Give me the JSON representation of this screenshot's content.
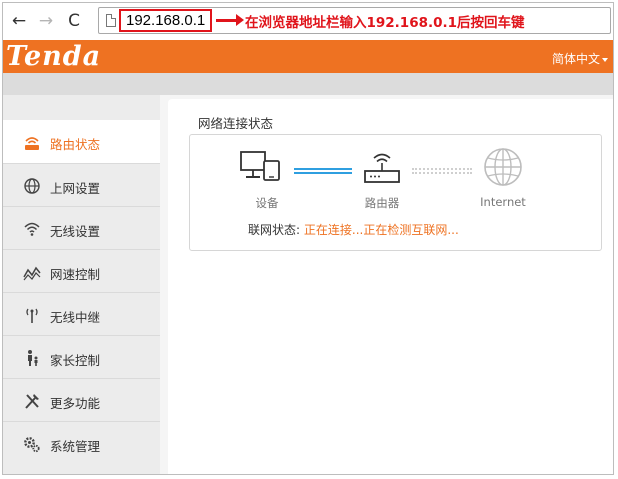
{
  "browser": {
    "back_icon": "back-arrow-icon",
    "forward_icon": "forward-arrow-icon",
    "reload_icon": "reload-icon",
    "page_icon": "page-icon",
    "url": "192.168.0.1",
    "annotation": "在浏览器地址栏输入192.168.0.1后按回车键",
    "annotation_color": "#e0141b"
  },
  "header": {
    "logo": "Tenda",
    "language": "简体中文",
    "brand_color": "#ee7222"
  },
  "sidebar": {
    "items": [
      {
        "label": "路由状态",
        "icon": "router-status-icon",
        "active": true
      },
      {
        "label": "上网设置",
        "icon": "globe-icon",
        "active": false
      },
      {
        "label": "无线设置",
        "icon": "wifi-icon",
        "active": false
      },
      {
        "label": "网速控制",
        "icon": "speed-wave-icon",
        "active": false
      },
      {
        "label": "无线中继",
        "icon": "antenna-icon",
        "active": false
      },
      {
        "label": "家长控制",
        "icon": "parent-child-icon",
        "active": false
      },
      {
        "label": "更多功能",
        "icon": "tools-icon",
        "active": false
      },
      {
        "label": "系统管理",
        "icon": "gears-icon",
        "active": false
      }
    ]
  },
  "main": {
    "section_title": "网络连接状态",
    "devices": [
      {
        "label": "设备",
        "icon": "device-icon"
      },
      {
        "label": "路由器",
        "icon": "router-icon"
      },
      {
        "label": "Internet",
        "icon": "internet-globe-icon"
      }
    ],
    "status_label": "联网状态:",
    "status_value": "正在连接...正在检测互联网..."
  }
}
